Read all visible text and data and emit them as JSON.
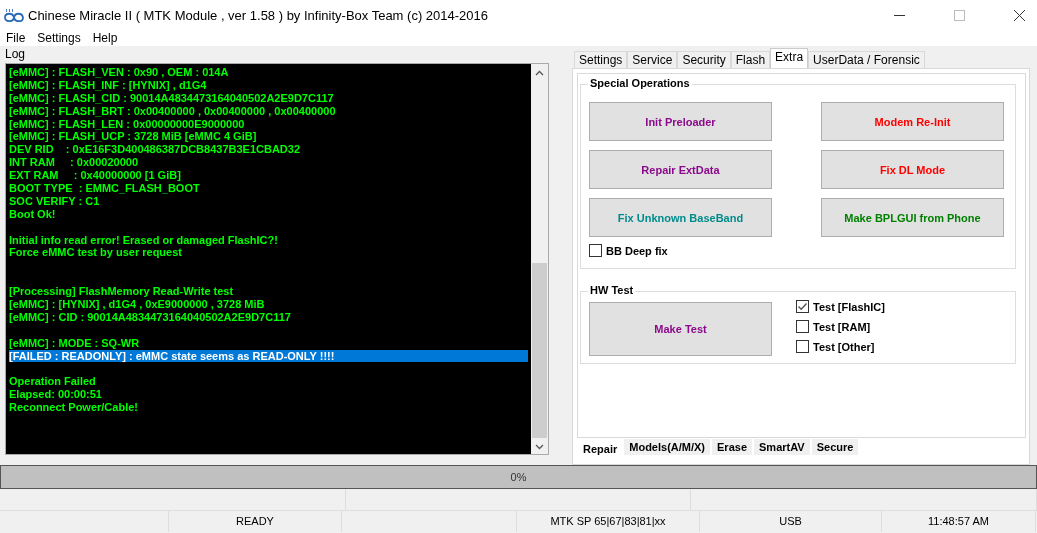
{
  "window": {
    "title": "Chinese Miracle II ( MTK Module , ver 1.58 ) by Infinity-Box Team (c) 2014-2016"
  },
  "menu": [
    "File",
    "Settings",
    "Help"
  ],
  "log": {
    "title": "Log",
    "lines": [
      {
        "kind": "text",
        "text": "[eMMC] : FLASH_VEN : 0x90 , OEM : 014A",
        "selected": false
      },
      {
        "kind": "text",
        "text": "[eMMC] : FLASH_INF : [HYNIX] , d1G4",
        "selected": false
      },
      {
        "kind": "text",
        "text": "[eMMC] : FLASH_CID : 90014A4834473164040502A2E9D7C117",
        "selected": false
      },
      {
        "kind": "text",
        "text": "[eMMC] : FLASH_BRT : 0x00400000 , 0x00400000 , 0x00400000",
        "selected": false
      },
      {
        "kind": "text",
        "text": "[eMMC] : FLASH_LEN : 0x00000000E9000000",
        "selected": false
      },
      {
        "kind": "text",
        "text": "[eMMC] : FLASH_UCP : 3728 MiB [eMMC 4 GiB]",
        "selected": false
      },
      {
        "kind": "text",
        "text": "DEV RID    : 0xE16F3D400486387DCB8437B3E1CBAD32",
        "selected": false
      },
      {
        "kind": "text",
        "text": "INT RAM     : 0x00020000",
        "selected": false
      },
      {
        "kind": "text",
        "text": "EXT RAM     : 0x40000000 [1 GiB]",
        "selected": false
      },
      {
        "kind": "text",
        "text": "BOOT TYPE  : EMMC_FLASH_BOOT",
        "selected": false
      },
      {
        "kind": "text",
        "text": "SOC VERIFY : C1",
        "selected": false
      },
      {
        "kind": "text",
        "text": "Boot Ok!",
        "selected": false
      },
      {
        "kind": "blank"
      },
      {
        "kind": "text",
        "text": "Initial info read error! Erased or damaged FlashIC?!",
        "selected": false
      },
      {
        "kind": "text",
        "text": "Force eMMC test by user request",
        "selected": false
      },
      {
        "kind": "blank"
      },
      {
        "kind": "blank"
      },
      {
        "kind": "text",
        "text": "[Processing] FlashMemory Read-Write test",
        "selected": false
      },
      {
        "kind": "text",
        "text": "[eMMC] : [HYNIX] , d1G4 , 0xE9000000 , 3728 MiB",
        "selected": false
      },
      {
        "kind": "text",
        "text": "[eMMC] : CID : 90014A4834473164040502A2E9D7C117",
        "selected": false
      },
      {
        "kind": "blank"
      },
      {
        "kind": "text",
        "text": "[eMMC] : MODE : SQ-WR",
        "selected": false
      },
      {
        "kind": "text",
        "text": "[FAILED : READONLY] : eMMC state seems as READ-ONLY !!!!",
        "selected": true
      },
      {
        "kind": "blank"
      },
      {
        "kind": "text",
        "text": "Operation Failed",
        "selected": false
      },
      {
        "kind": "text",
        "text": "Elapsed: 00:00:51",
        "selected": false
      },
      {
        "kind": "text",
        "text": "Reconnect Power/Cable!",
        "selected": false
      }
    ]
  },
  "top_tabs": [
    {
      "label": "Settings",
      "selected": false
    },
    {
      "label": "Service",
      "selected": false
    },
    {
      "label": "Security",
      "selected": false
    },
    {
      "label": "Flash",
      "selected": false
    },
    {
      "label": "Extra",
      "selected": true
    },
    {
      "label": "UserData / Forensic",
      "selected": false
    }
  ],
  "special_operations": {
    "title": "Special Operations",
    "buttons": [
      {
        "label": "Init Preloader",
        "color": "#8b0a8b"
      },
      {
        "label": "Modem Re-Init",
        "color": "#ff0000"
      },
      {
        "label": "Repair ExtData",
        "color": "#8b0a8b"
      },
      {
        "label": "Fix DL Mode",
        "color": "#ff0000"
      },
      {
        "label": "Fix Unknown BaseBand",
        "color": "#008b8b"
      },
      {
        "label": "Make BPLGUI from Phone",
        "color": "#008000"
      }
    ],
    "checkbox": {
      "label": "BB Deep fix",
      "checked": false
    }
  },
  "hw_test": {
    "title": "HW Test",
    "button": {
      "label": "Make Test",
      "color": "#8b0a8b"
    },
    "checks": [
      {
        "label": "Test [FlashIC]",
        "checked": true
      },
      {
        "label": "Test [RAM]",
        "checked": false
      },
      {
        "label": "Test [Other]",
        "checked": false
      }
    ]
  },
  "bottom_tabs": [
    {
      "label": "Repair",
      "selected": true
    },
    {
      "label": "Models(A/M/X)",
      "selected": false
    },
    {
      "label": "Erase",
      "selected": false
    },
    {
      "label": "SmartAV",
      "selected": false
    },
    {
      "label": "Secure",
      "selected": false
    }
  ],
  "progress": {
    "level": 0,
    "text": "0%"
  },
  "status_bar": [
    "READY",
    "MTK SP 65|67|83|81|xx",
    "USB",
    "11:48:57 AM"
  ]
}
